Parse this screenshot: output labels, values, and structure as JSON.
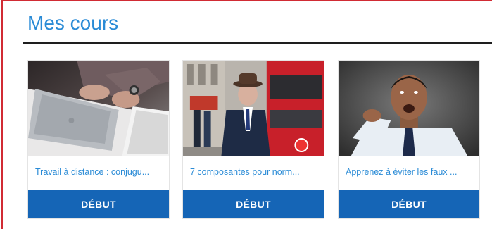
{
  "header": {
    "title": "Mes cours"
  },
  "courses": [
    {
      "title": "Travail à distance : conjugu...",
      "button_label": "DÉBUT",
      "image": "laptop-hands-photo"
    },
    {
      "title": "7 composantes pour norm...",
      "button_label": "DÉBUT",
      "image": "old-man-london-bus-photo"
    },
    {
      "title": "Apprenez à éviter les faux ...",
      "button_label": "DÉBUT",
      "image": "man-pointing-shouting-photo"
    }
  ],
  "colors": {
    "accent": "#2a8bd6",
    "button": "#1565b6",
    "frame": "#d12b34"
  }
}
